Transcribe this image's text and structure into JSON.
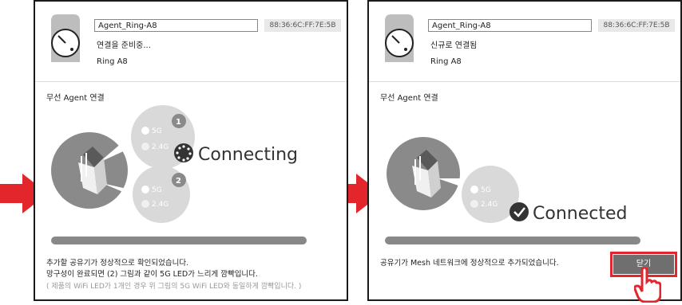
{
  "left_panel": {
    "device_name": "Agent_Ring-A8",
    "mac": "88:36:6C:FF:7E:5B",
    "status": "연결을 준비중...",
    "model": "Ring A8",
    "section_label": "무선 Agent 연결",
    "band_5g": "5G",
    "band_24g": "2.4G",
    "step1": "1",
    "step2": "2",
    "big_status": "Connecting",
    "message_line1": "추가할 공유기가 정상적으로 확인되었습니다.",
    "message_line2": "망구성이 완료되면 (2) 그림과 같이 5G LED가 느리게 깜빡입니다.",
    "message_note": "( 제품의 WiFi LED가 1개인 경우 위 그림의 5G WiFi LED와 동일하게 깜빡입니다. )"
  },
  "right_panel": {
    "device_name": "Agent_Ring-A8",
    "mac": "88:36:6C:FF:7E:5B",
    "status": "신규로 연결됨",
    "model": "Ring A8",
    "section_label": "무선 Agent 연결",
    "band_5g": "5G",
    "band_24g": "2.4G",
    "big_status": "Connected",
    "message": "공유기가 Mesh 네트워크에 정상적으로 추가되었습니다.",
    "close_label": "닫기"
  },
  "colors": {
    "arrow": "#e3262c",
    "highlight": "#e3262c",
    "button": "#6f6f6f"
  }
}
